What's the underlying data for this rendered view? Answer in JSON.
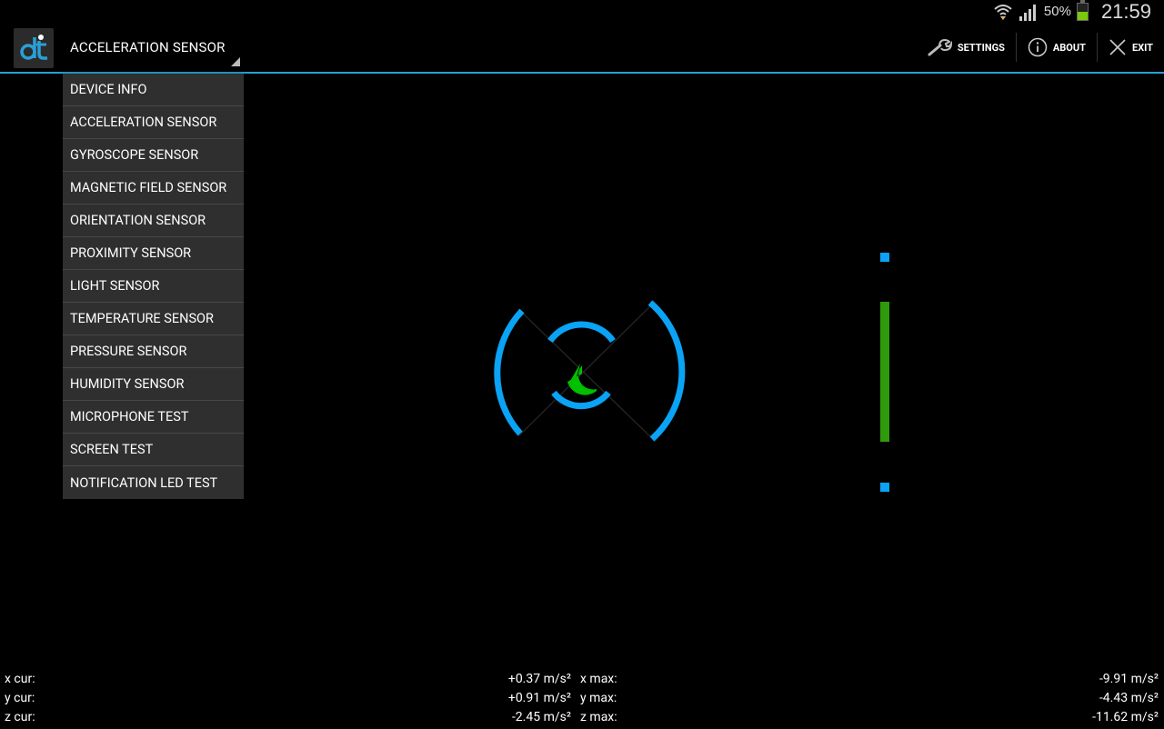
{
  "status": {
    "battery_text": "50%",
    "battery_level": 0.5,
    "clock": "21:59",
    "icons": [
      "wifi-icon",
      "signal-icon",
      "battery-icon"
    ]
  },
  "app": {
    "logo_text": "dt",
    "selected_sensor": "ACCELERATION SENSOR"
  },
  "actions": {
    "settings": "SETTINGS",
    "about": "ABOUT",
    "exit": "EXIT"
  },
  "menu": {
    "items": [
      "DEVICE INFO",
      "ACCELERATION SENSOR",
      "GYROSCOPE SENSOR",
      "MAGNETIC FIELD SENSOR",
      "ORIENTATION SENSOR",
      "PROXIMITY SENSOR",
      "LIGHT SENSOR",
      "TEMPERATURE SENSOR",
      "PRESSURE SENSOR",
      "HUMIDITY SENSOR",
      "MICROPHONE TEST",
      "SCREEN TEST",
      "NOTIFICATION LED TEST"
    ]
  },
  "colors": {
    "accent": "#2a9fd6",
    "ring": "#0aa3f5",
    "indicator": "#00c000",
    "bar": "#2e9b0c"
  },
  "readouts": {
    "x_cur_label": "x cur:",
    "x_cur_value": "+0.37 m/s²",
    "x_max_label": "x max:",
    "x_max_value": "-9.91 m/s²",
    "y_cur_label": "y cur:",
    "y_cur_value": "+0.91 m/s²",
    "y_max_label": "y max:",
    "y_max_value": "-4.43 m/s²",
    "z_cur_label": "z cur:",
    "z_cur_value": "-2.45 m/s²",
    "z_max_label": "z max:",
    "z_max_value": "-11.62 m/s²"
  }
}
